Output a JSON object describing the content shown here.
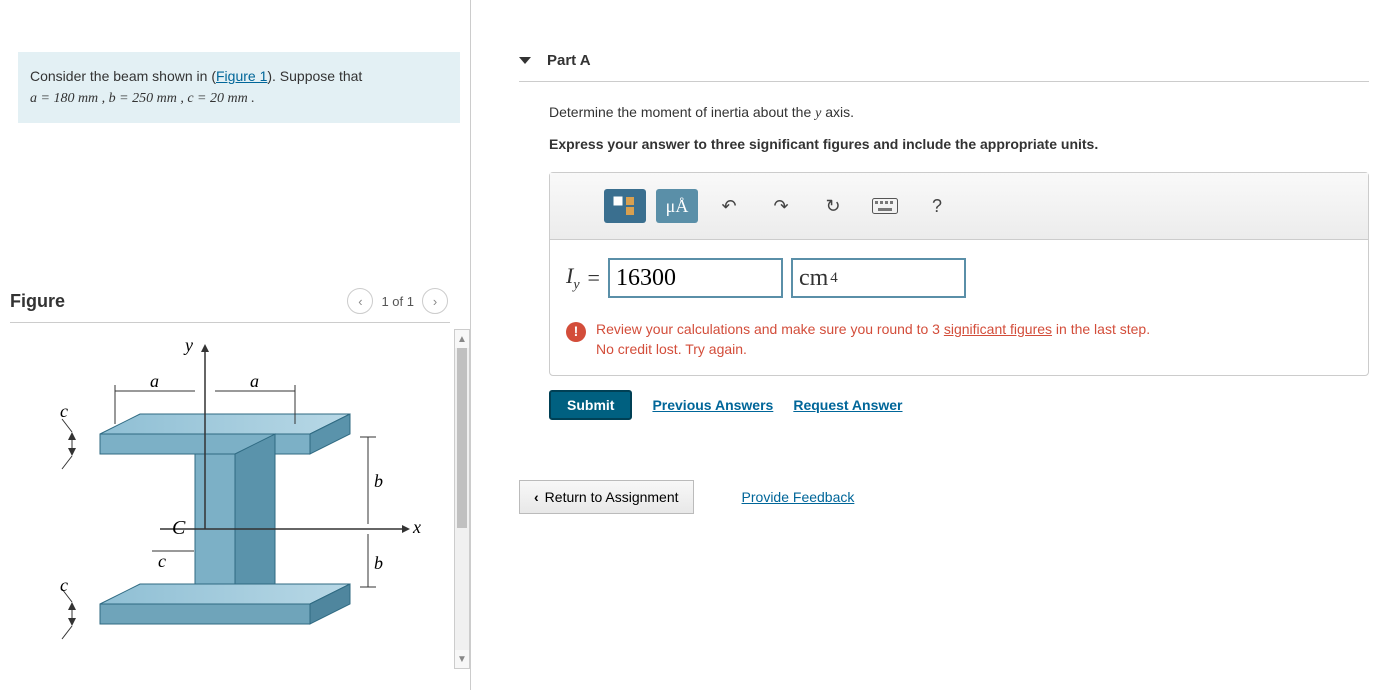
{
  "problem": {
    "lead": "Consider the beam shown in (",
    "figureLinkText": "Figure 1",
    "tail": "). Suppose that",
    "params": "a = 180  mm , b = 250  mm , c = 20  mm ."
  },
  "figure": {
    "title": "Figure",
    "pager": "1 of 1",
    "labels": {
      "a": "a",
      "b": "b",
      "c": "c",
      "x": "x",
      "y": "y",
      "C": "C"
    }
  },
  "part": {
    "label": "Part A",
    "question_pre": "Determine the moment of inertia about the ",
    "question_var": "y",
    "question_post": " axis.",
    "instruction": "Express your answer to three significant figures and include the appropriate units."
  },
  "toolbar": {
    "units": "μÅ",
    "help": "?"
  },
  "answer": {
    "prefix_var": "I",
    "prefix_sub": "y",
    "equals": " = ",
    "value": "16300",
    "unit_base": "cm",
    "unit_exp": "4"
  },
  "feedback": {
    "msg1a": "Review your calculations and make sure you round to 3 ",
    "msg1_ul": "significant figures",
    "msg1b": " in the last step.",
    "msg2": "No credit lost. Try again."
  },
  "buttons": {
    "submit": "Submit",
    "prev": "Previous Answers",
    "req": "Request Answer",
    "return": "Return to Assignment",
    "feedback": "Provide Feedback"
  }
}
